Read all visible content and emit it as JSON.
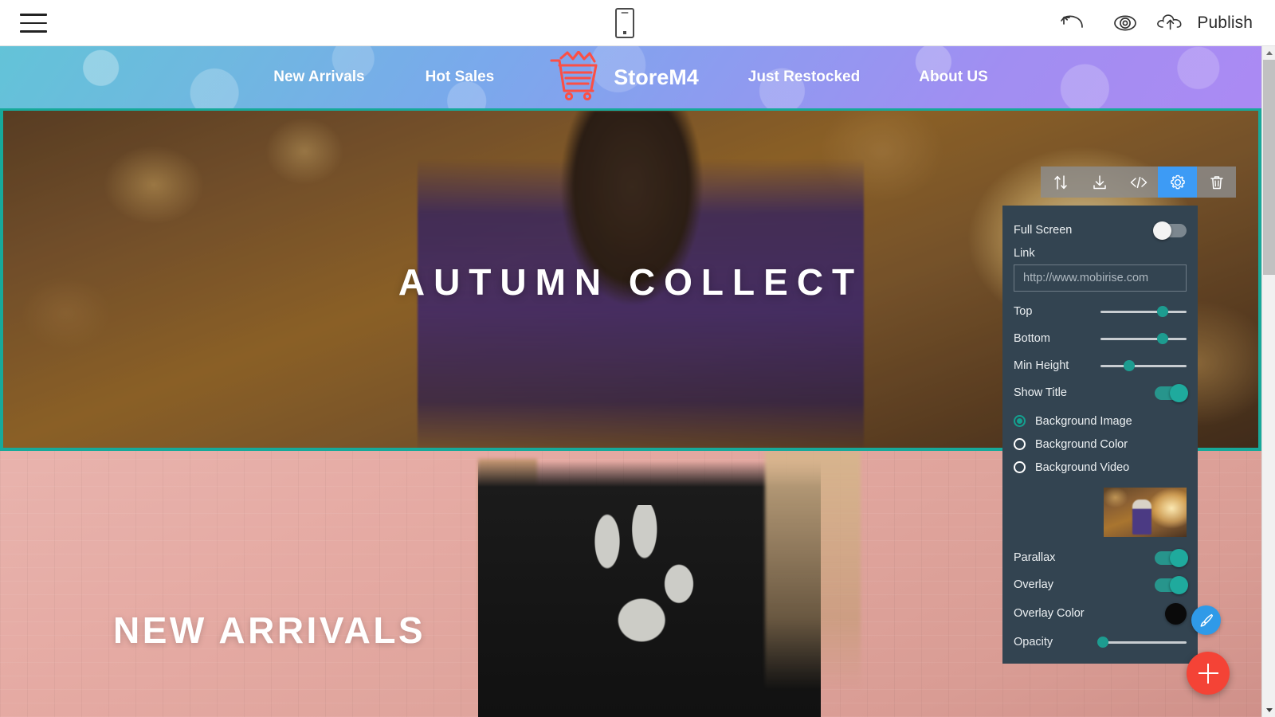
{
  "app": {
    "menu_icon": "hamburger-icon",
    "device_icon": "mobile-preview-icon",
    "undo_icon": "undo-arrow-icon",
    "preview_icon": "eye-icon",
    "publish_icon": "cloud-upload-icon",
    "publish_label": "Publish"
  },
  "site": {
    "nav_left": [
      {
        "label": "New Arrivals"
      },
      {
        "label": "Hot Sales"
      }
    ],
    "brand": {
      "logo_icon": "shopping-cart-icon",
      "logo_color": "#fc4f45",
      "name": "StoreM4"
    },
    "nav_right": [
      {
        "label": "Just Restocked"
      },
      {
        "label": "About US"
      }
    ],
    "hero": {
      "title": "AUTUMN COLLECT",
      "selection_color": "#17a99a"
    },
    "arrivals": {
      "title": "NEW ARRIVALS"
    }
  },
  "block_toolbar": {
    "buttons": [
      {
        "name": "move-block",
        "icon": "up-down-arrows-icon",
        "active": false
      },
      {
        "name": "save-block",
        "icon": "download-tray-icon",
        "active": false
      },
      {
        "name": "edit-code",
        "icon": "code-brackets-icon",
        "active": false
      },
      {
        "name": "block-settings",
        "icon": "gear-icon",
        "active": true
      },
      {
        "name": "delete-block",
        "icon": "trash-icon",
        "active": false
      }
    ],
    "active_color": "#3d9bf5"
  },
  "settings": {
    "full_screen": {
      "label": "Full Screen",
      "value": "off"
    },
    "link": {
      "label": "Link",
      "value": "",
      "placeholder": "http://www.mobirise.com"
    },
    "sliders": [
      {
        "label": "Top",
        "percent": 72
      },
      {
        "label": "Bottom",
        "percent": 72
      },
      {
        "label": "Min Height",
        "percent": 33
      }
    ],
    "show_title": {
      "label": "Show Title",
      "value": "on"
    },
    "background_options": [
      {
        "label": "Background Image",
        "selected": true
      },
      {
        "label": "Background Color",
        "selected": false
      },
      {
        "label": "Background Video",
        "selected": false
      }
    ],
    "thumbnail_name": "background-image-thumbnail",
    "parallax": {
      "label": "Parallax",
      "value": "on"
    },
    "overlay": {
      "label": "Overlay",
      "value": "on"
    },
    "overlay_color": {
      "label": "Overlay Color",
      "value": "#0a0a0a"
    },
    "opacity": {
      "label": "Opacity",
      "percent": 2
    },
    "panel_color": "#334451",
    "accent_color": "#1d9c90"
  },
  "fabs": {
    "style_icon": "paintbrush-icon",
    "style_color": "#2f9ae8",
    "add_icon": "plus-icon",
    "add_color": "#f44336"
  },
  "scrollbar": {
    "up_icon": "triangle-up-icon",
    "down_icon": "triangle-down-icon"
  }
}
